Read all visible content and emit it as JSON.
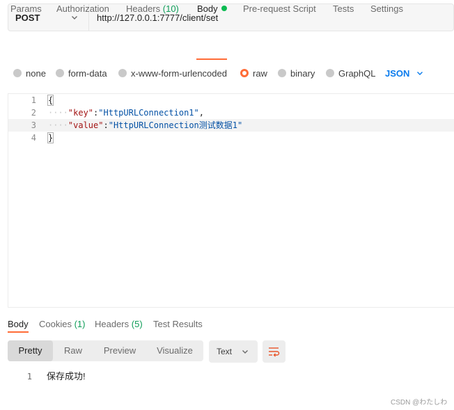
{
  "request": {
    "method": "POST",
    "url": "http://127.0.0.1:7777/client/set"
  },
  "tabs": [
    {
      "label": "Params"
    },
    {
      "label": "Authorization"
    },
    {
      "label": "Headers",
      "count": "(10)"
    },
    {
      "label": "Body",
      "active": true
    },
    {
      "label": "Pre-request Script"
    },
    {
      "label": "Tests"
    },
    {
      "label": "Settings"
    }
  ],
  "body_modes": {
    "options": [
      "none",
      "form-data",
      "x-www-form-urlencoded",
      "raw",
      "binary",
      "GraphQL"
    ],
    "selected": "raw",
    "format": "JSON"
  },
  "editor": {
    "line_numbers": [
      "1",
      "2",
      "3",
      "4"
    ],
    "open_brace": "{",
    "close_brace": "}",
    "indent_guide": "····",
    "key1": "\"key\"",
    "val1": "\"HttpURLConnection1\"",
    "key2": "\"value\"",
    "val2": "\"HttpURLConnection测试数据1\"",
    "colon": ":",
    "comma": ","
  },
  "response": {
    "tabs": [
      {
        "label": "Body",
        "active": true
      },
      {
        "label": "Cookies",
        "count": "(1)"
      },
      {
        "label": "Headers",
        "count": "(5)"
      },
      {
        "label": "Test Results"
      }
    ],
    "views": [
      "Pretty",
      "Raw",
      "Preview",
      "Visualize"
    ],
    "active_view": "Pretty",
    "format": "Text",
    "line_number": "1",
    "content": "保存成功!"
  },
  "watermark": "CSDN @わたしわ",
  "colors": {
    "accent": "#ff6c37",
    "json_blue": "#097bed",
    "count_green": "#0f9d58",
    "dot_green": "#0cbb52"
  },
  "icons": {
    "method_dropdown": "chevron-down-icon",
    "format_dropdown": "chevron-down-icon",
    "wrap": "wrap-lines-icon"
  }
}
